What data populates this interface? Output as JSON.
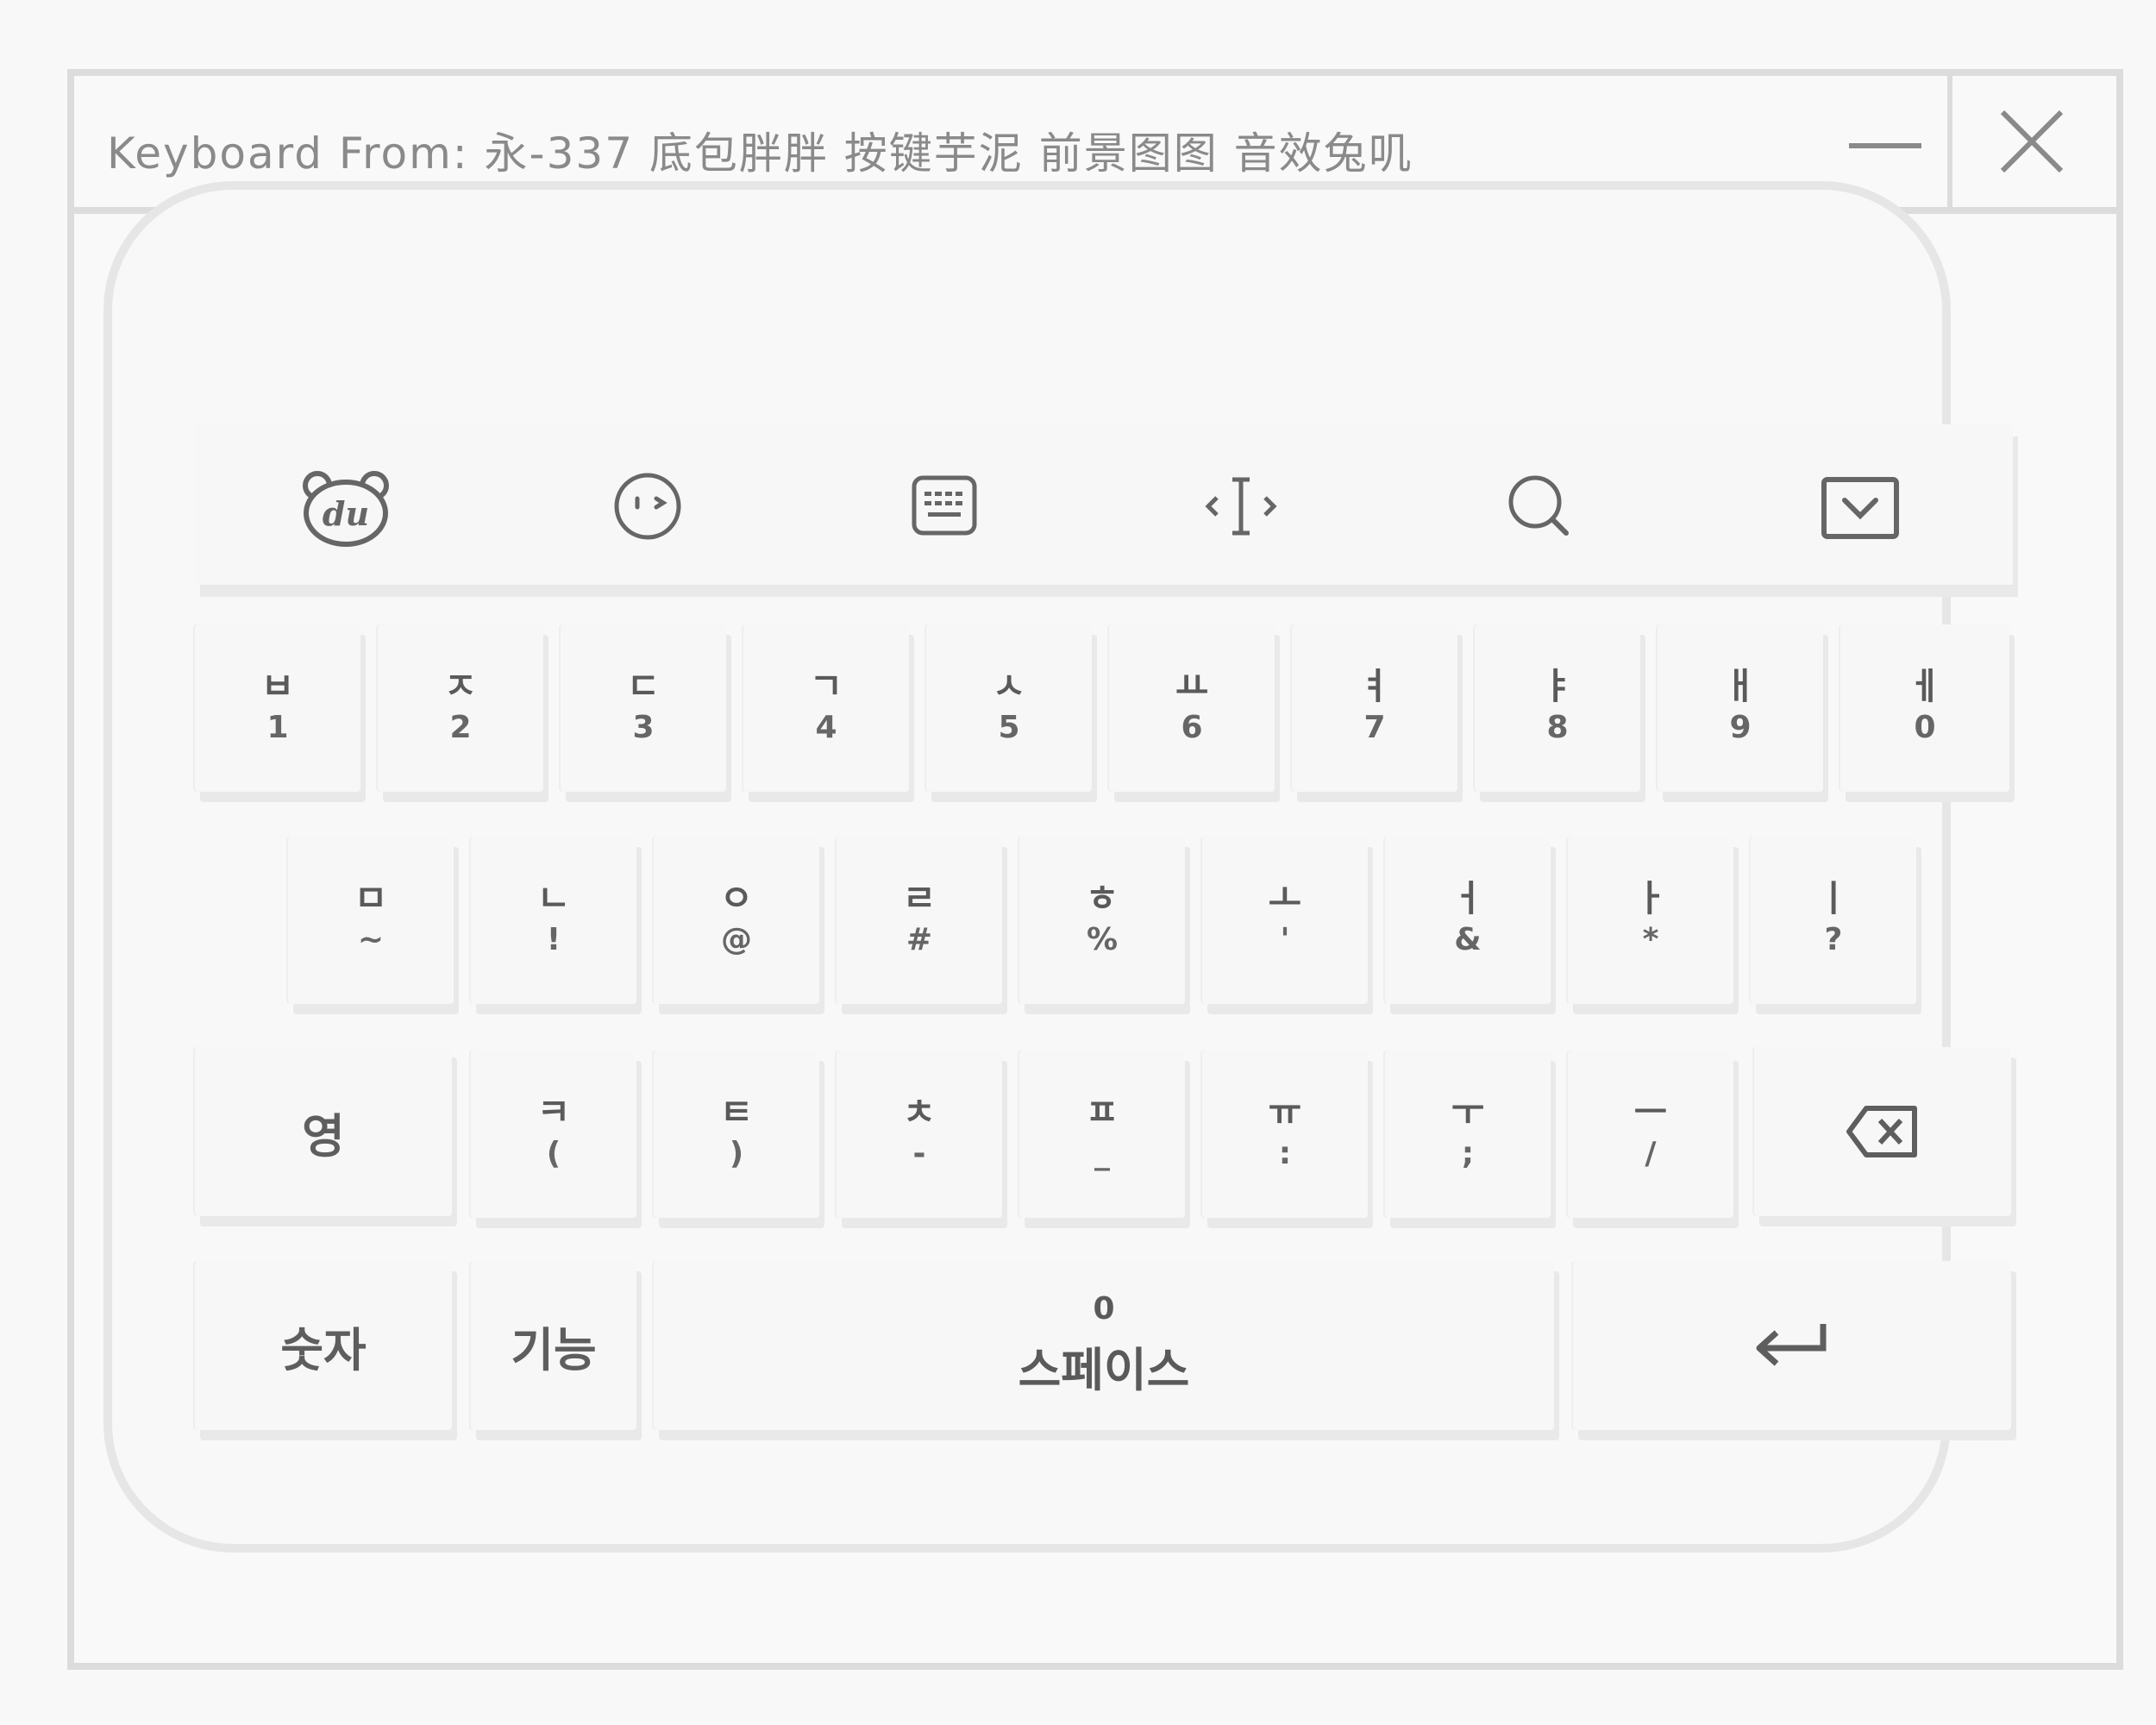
{
  "window": {
    "title": "Keyboard From: 永-337 底包胖胖 按键芋泥 前景图图 音效兔叽"
  },
  "toolbar": {
    "icons": [
      "du-bear-logo-icon",
      "emoji-face-icon",
      "keyboard-icon",
      "cursor-move-icon",
      "search-icon",
      "collapse-icon"
    ]
  },
  "rows": {
    "row1": [
      {
        "main": "ㅂ",
        "sub": "1"
      },
      {
        "main": "ㅈ",
        "sub": "2"
      },
      {
        "main": "ㄷ",
        "sub": "3"
      },
      {
        "main": "ㄱ",
        "sub": "4"
      },
      {
        "main": "ㅅ",
        "sub": "5"
      },
      {
        "main": "ㅛ",
        "sub": "6"
      },
      {
        "main": "ㅕ",
        "sub": "7"
      },
      {
        "main": "ㅑ",
        "sub": "8"
      },
      {
        "main": "ㅐ",
        "sub": "9"
      },
      {
        "main": "ㅔ",
        "sub": "0"
      }
    ],
    "row2": [
      {
        "main": "ㅁ",
        "sub": "~"
      },
      {
        "main": "ㄴ",
        "sub": "!"
      },
      {
        "main": "ㅇ",
        "sub": "@"
      },
      {
        "main": "ㄹ",
        "sub": "#"
      },
      {
        "main": "ㅎ",
        "sub": "%"
      },
      {
        "main": "ㅗ",
        "sub": "'"
      },
      {
        "main": "ㅓ",
        "sub": "&"
      },
      {
        "main": "ㅏ",
        "sub": "*"
      },
      {
        "main": "ㅣ",
        "sub": "?"
      }
    ],
    "row3": [
      {
        "main": "ㅋ",
        "sub": "("
      },
      {
        "main": "ㅌ",
        "sub": ")"
      },
      {
        "main": "ㅊ",
        "sub": "-"
      },
      {
        "main": "ㅍ",
        "sub": "_"
      },
      {
        "main": "ㅠ",
        "sub": ":"
      },
      {
        "main": "ㅜ",
        "sub": ";"
      },
      {
        "main": "ㅡ",
        "sub": "/"
      }
    ],
    "lang_key": "영",
    "number_key": "숫자",
    "function_key": "기능",
    "space_top": "0",
    "space_label": "스페이스",
    "enter_symbol": "↵"
  }
}
